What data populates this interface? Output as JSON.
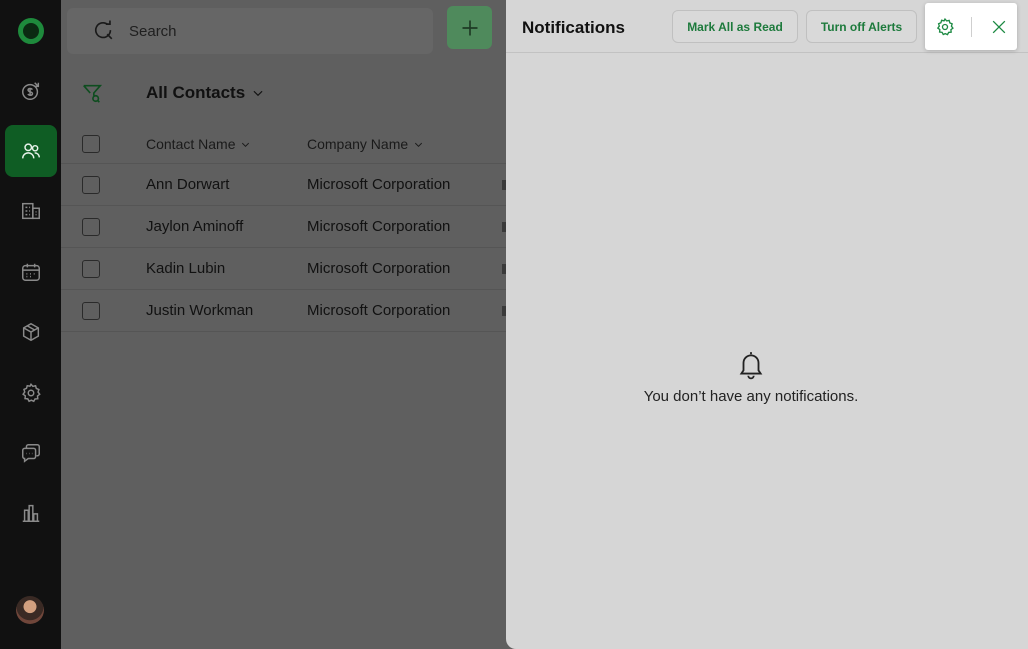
{
  "search": {
    "placeholder": "Search"
  },
  "view": {
    "title": "All Contacts"
  },
  "table": {
    "columns": [
      "Contact Name",
      "Company Name"
    ],
    "rows": [
      {
        "contact": "Ann Dorwart",
        "company": "Microsoft Corporation"
      },
      {
        "contact": "Jaylon Aminoff",
        "company": "Microsoft Corporation"
      },
      {
        "contact": "Kadin Lubin",
        "company": "Microsoft Corporation"
      },
      {
        "contact": "Justin Workman",
        "company": "Microsoft Corporation"
      }
    ]
  },
  "notifications": {
    "title": "Notifications",
    "mark_all_read": "Mark All as Read",
    "turn_off_alerts": "Turn off Alerts",
    "empty_message": "You don’t have any notifications."
  },
  "icons": {
    "rail": [
      "deals-icon",
      "contacts-icon",
      "companies-icon",
      "calendar-icon",
      "products-icon",
      "settings-icon",
      "chat-icon",
      "reports-icon"
    ]
  },
  "colors": {
    "accent": "#1d8a43",
    "rail_bg": "#111111",
    "active_rail": "#0f5d24",
    "panel_bg": "#d6d6d6"
  }
}
